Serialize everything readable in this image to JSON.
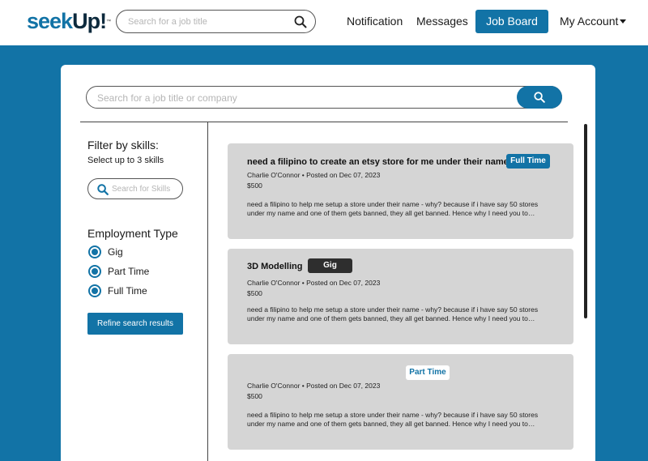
{
  "header": {
    "logo_seek": "seek",
    "logo_up": "Up!",
    "logo_tm": "™",
    "search_placeholder": "Search for a job title",
    "nav": {
      "notification": "Notification",
      "messages": "Messages",
      "job_board": "Job Board",
      "my_account": "My Account"
    }
  },
  "main_search": {
    "placeholder": "Search for a job title or company"
  },
  "sidebar": {
    "filter_title": "Filter by skills:",
    "filter_sub": "Select up to 3 skills",
    "skills_placeholder": "Search for Skills",
    "employment_title": "Employment Type",
    "options": [
      {
        "label": "Gig",
        "selected": true
      },
      {
        "label": "Part Time",
        "selected": true
      },
      {
        "label": "Full Time",
        "selected": true
      }
    ],
    "refine_label": "Refine search results"
  },
  "jobs": [
    {
      "title": "need a filipino to create an etsy store for me under their name",
      "badge": "Full Time",
      "meta": "Charlie O'Connor • Posted on Dec 07, 2023",
      "price": "$500",
      "desc": "need a filipino to help me setup a store under their name - why? because if i have say 50 stores under my name and one of them gets banned, they all get banned. Hence why I need you to…"
    },
    {
      "title": "3D Modelling",
      "badge": "Gig",
      "meta": "Charlie O'Connor • Posted on Dec 07, 2023",
      "price": "$500",
      "desc": "need a filipino to help me setup a store under their name - why? because if i have say 50 stores under my name and one of them gets banned, they all get banned. Hence why I need you to…"
    },
    {
      "title": "",
      "badge": "Part Time",
      "meta": "Charlie O'Connor • Posted on Dec 07, 2023",
      "price": "$500",
      "desc": "need a filipino to help me setup a store under their name - why? because if i have say 50 stores under my name and one of them gets banned, they all get banned. Hence why I need you to…"
    }
  ],
  "colors": {
    "brand": "#1273a6",
    "dark_badge": "#2e2e2e",
    "card_bg": "#d5d5d5"
  }
}
